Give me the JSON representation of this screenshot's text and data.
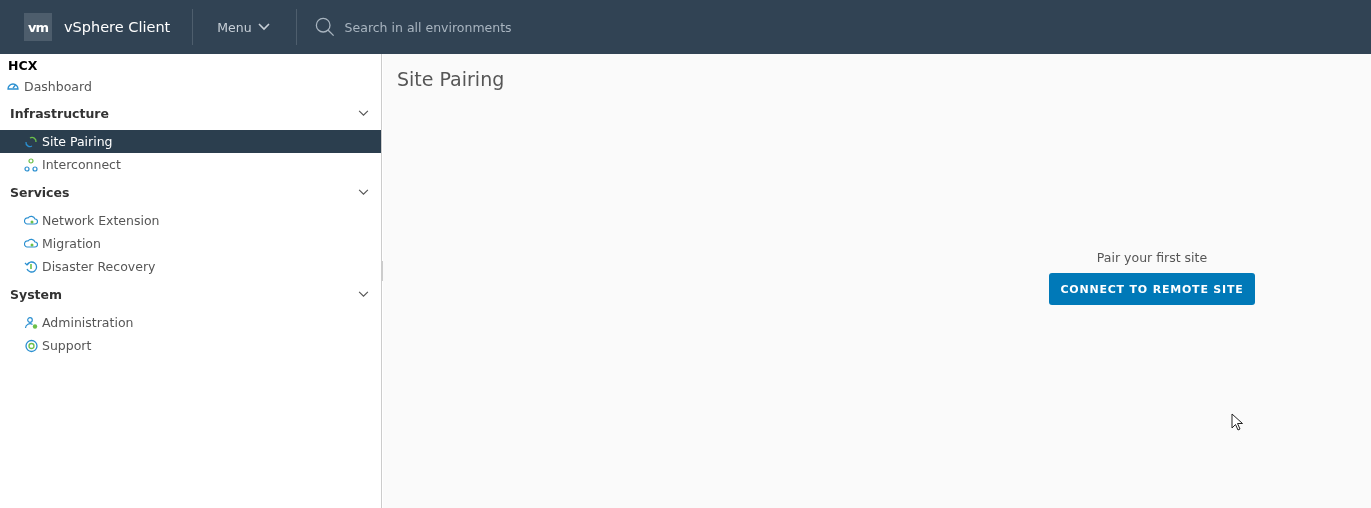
{
  "header": {
    "logo": "vm",
    "title": "vSphere Client",
    "menu": "Menu",
    "search": {
      "placeholder": "Search in all environments"
    }
  },
  "sidebar": {
    "title": "HCX",
    "top_items": [
      {
        "label": "Dashboard",
        "selected": false
      }
    ],
    "sections": [
      {
        "label": "Infrastructure",
        "expanded": true,
        "items": [
          {
            "label": "Site Pairing",
            "selected": true
          },
          {
            "label": "Interconnect",
            "selected": false
          }
        ]
      },
      {
        "label": "Services",
        "expanded": true,
        "items": [
          {
            "label": "Network Extension",
            "selected": false
          },
          {
            "label": "Migration",
            "selected": false
          },
          {
            "label": "Disaster Recovery",
            "selected": false
          }
        ]
      },
      {
        "label": "System",
        "expanded": true,
        "items": [
          {
            "label": "Administration",
            "selected": false
          },
          {
            "label": "Support",
            "selected": false
          }
        ]
      }
    ]
  },
  "main": {
    "title": "Site Pairing",
    "empty_message": "Pair your first site",
    "button": "CONNECT TO REMOTE SITE"
  }
}
